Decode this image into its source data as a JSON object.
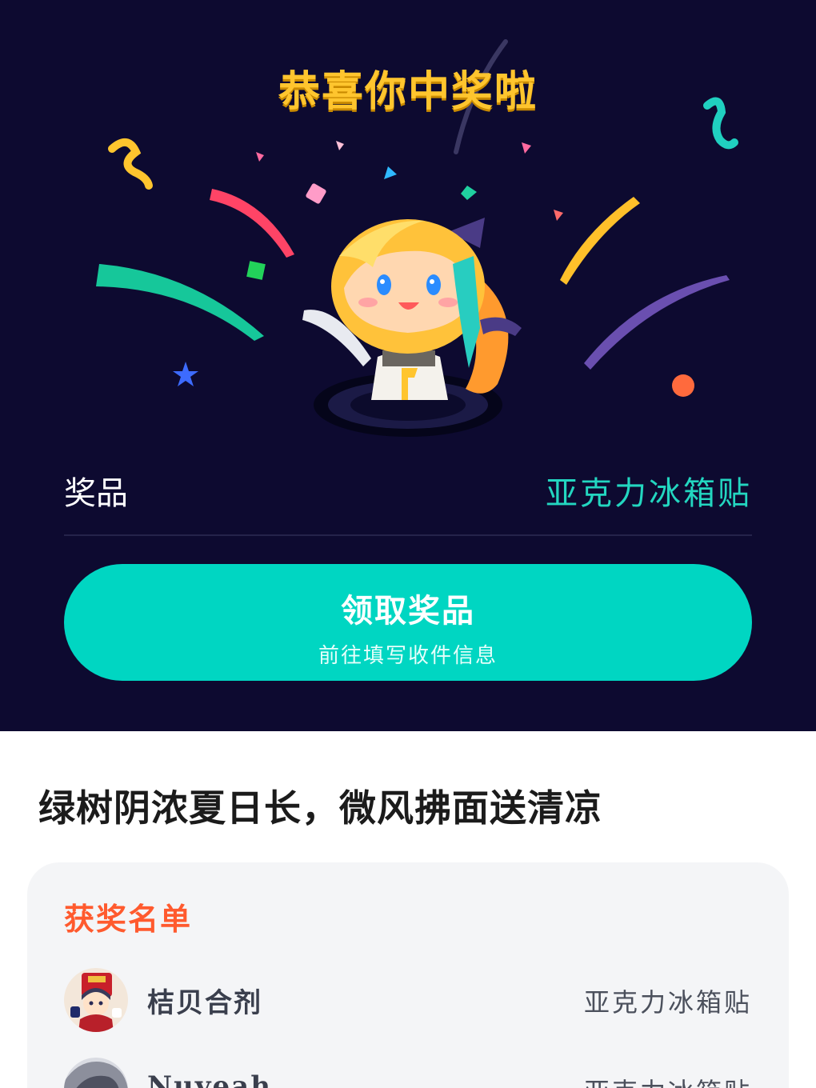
{
  "hero": {
    "title": "恭喜你中奖啦",
    "prize_label": "奖品",
    "prize_value": "亚克力冰箱贴",
    "claim_button": {
      "label": "领取奖品",
      "sublabel": "前往填写收件信息"
    }
  },
  "headline": "绿树阴浓夏日长，微风拂面送清凉",
  "winners": {
    "title": "获奖名单",
    "items": [
      {
        "name": "桔贝合剂",
        "prize": "亚克力冰箱贴"
      },
      {
        "name": "Nuyeah",
        "prize": "亚克力冰箱贴"
      }
    ]
  },
  "colors": {
    "hero_bg": "#0d0a30",
    "accent_teal": "#00d6c2",
    "title_gold": "#ffc52e",
    "winners_title": "#ff5a2e"
  },
  "icons": [
    "confetti-graphic",
    "mascot-illustration",
    "avatar-image"
  ]
}
